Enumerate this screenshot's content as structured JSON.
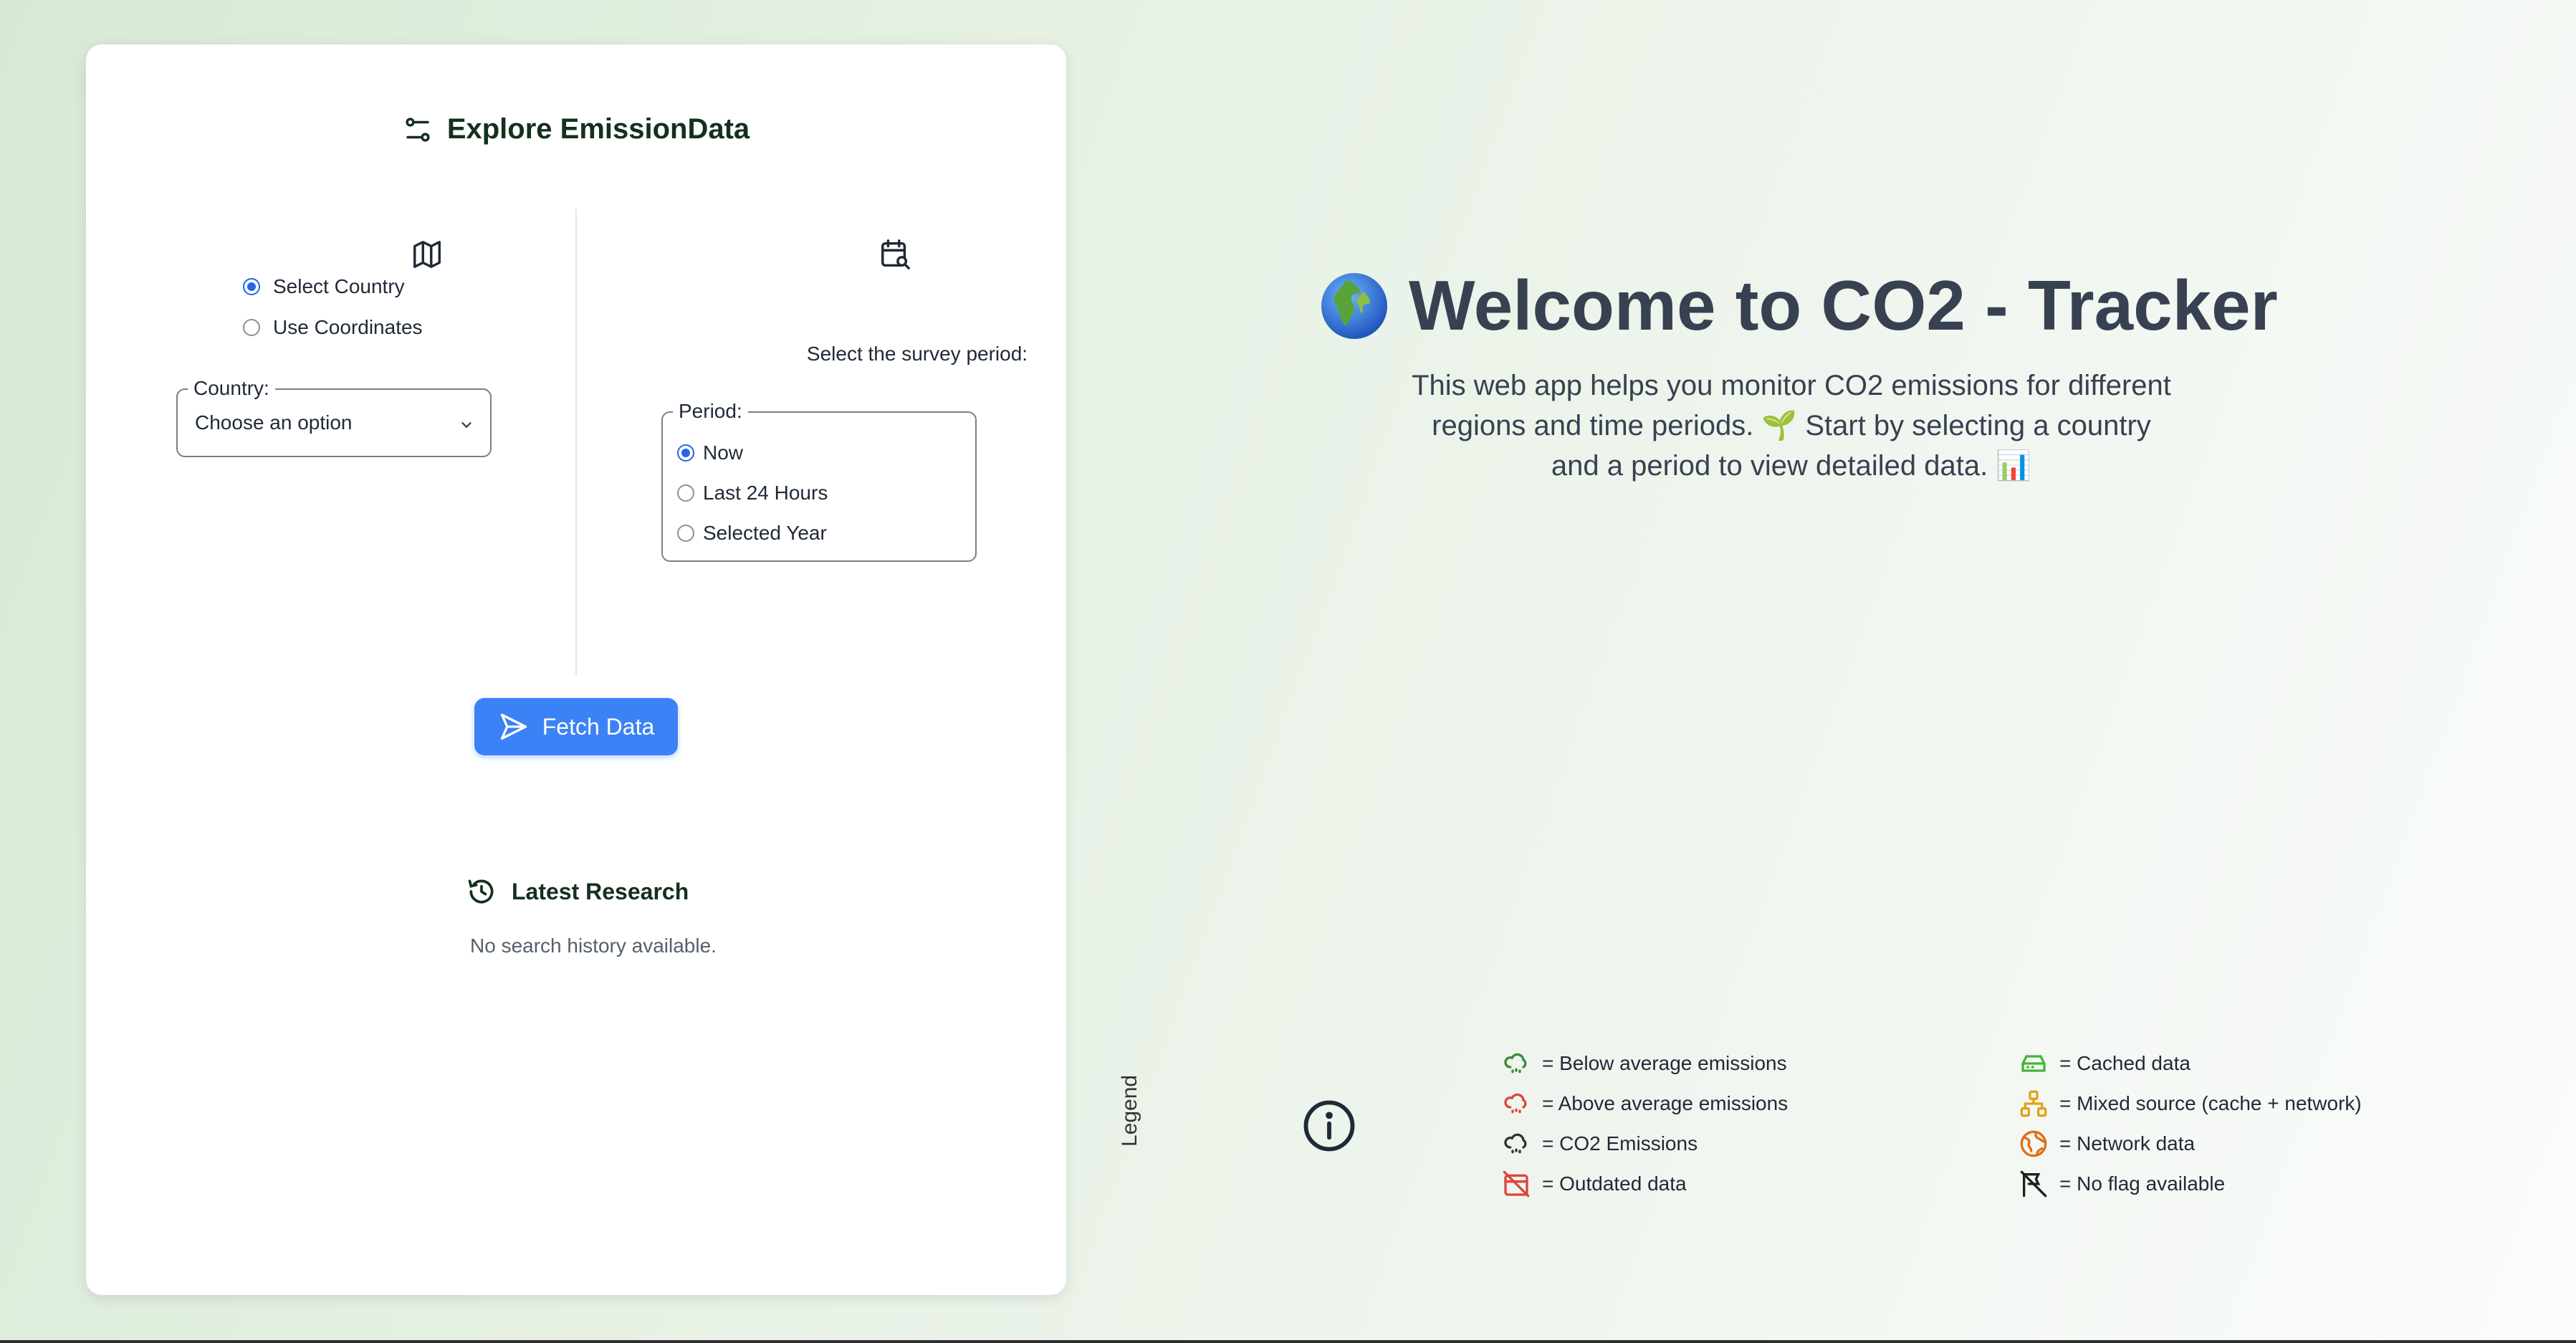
{
  "panel": {
    "title": "Explore EmissionData",
    "location_mode": {
      "options": [
        "Select Country",
        "Use Coordinates"
      ],
      "selected": "Select Country"
    },
    "country": {
      "label": "Country:",
      "value": "Choose an option"
    },
    "period_prompt": "Select the survey period:",
    "period": {
      "label": "Period:",
      "options": [
        "Now",
        "Last 24 Hours",
        "Selected Year"
      ],
      "selected": "Now"
    },
    "fetch_label": "Fetch Data",
    "latest_title": "Latest Research",
    "no_history": "No search history available."
  },
  "welcome": {
    "title": "Welcome to CO2 - Tracker",
    "intro": "This web app helps you monitor CO2 emissions for different regions and time periods. 🌱 Start by selecting a country and a period to view detailed data. 📊"
  },
  "legend": {
    "label": "Legend",
    "items": [
      {
        "icon": "cloud-green-icon",
        "text": "= Below average emissions",
        "color": "#3a8a3a"
      },
      {
        "icon": "cloud-red-icon",
        "text": "= Above average emissions",
        "color": "#e0443b"
      },
      {
        "icon": "cloud-dark-icon",
        "text": "= CO2 Emissions",
        "color": "#333333"
      },
      {
        "icon": "calendar-off-icon",
        "text": "= Outdated data",
        "color": "#e0443b"
      },
      {
        "icon": "hard-drive-icon",
        "text": "= Cached data",
        "color": "#43b53a"
      },
      {
        "icon": "network-icon",
        "text": "= Mixed source (cache + network)",
        "color": "#e3a21a"
      },
      {
        "icon": "globe-icon",
        "text": "= Network data",
        "color": "#e36c1a"
      },
      {
        "icon": "flag-off-icon",
        "text": "= No flag available",
        "color": "#1f1f1f"
      }
    ]
  }
}
